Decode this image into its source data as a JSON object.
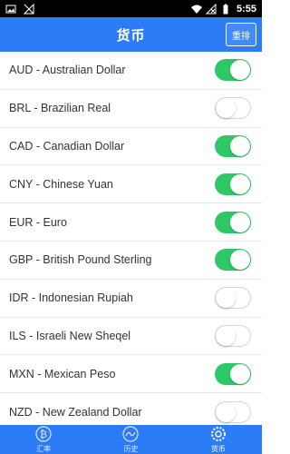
{
  "status_bar": {
    "time": "5:55",
    "left_icons": [
      "image-icon",
      "no-signal-icon"
    ],
    "right_icons": [
      "wifi-icon",
      "cellular-off-icon",
      "battery-icon"
    ]
  },
  "header": {
    "title": "货币",
    "sort_label": "重排"
  },
  "currencies": [
    {
      "label": "AUD - Australian Dollar",
      "enabled": true
    },
    {
      "label": "BRL - Brazilian Real",
      "enabled": false
    },
    {
      "label": "CAD - Canadian Dollar",
      "enabled": true
    },
    {
      "label": "CNY - Chinese Yuan",
      "enabled": true
    },
    {
      "label": "EUR - Euro",
      "enabled": true
    },
    {
      "label": "GBP - British Pound Sterling",
      "enabled": true
    },
    {
      "label": "IDR - Indonesian Rupiah",
      "enabled": false
    },
    {
      "label": "ILS - Israeli New Sheqel",
      "enabled": false
    },
    {
      "label": "MXN - Mexican Peso",
      "enabled": true
    },
    {
      "label": "NZD - New Zealand Dollar",
      "enabled": false
    }
  ],
  "tabs": [
    {
      "label": "汇率",
      "icon": "bitcoin-icon",
      "active": false
    },
    {
      "label": "历史",
      "icon": "chart-circle-icon",
      "active": false
    },
    {
      "label": "货币",
      "icon": "gear-icon",
      "active": true
    }
  ],
  "colors": {
    "primary": "#2b7cf6",
    "toggle_on": "#2ec866"
  }
}
